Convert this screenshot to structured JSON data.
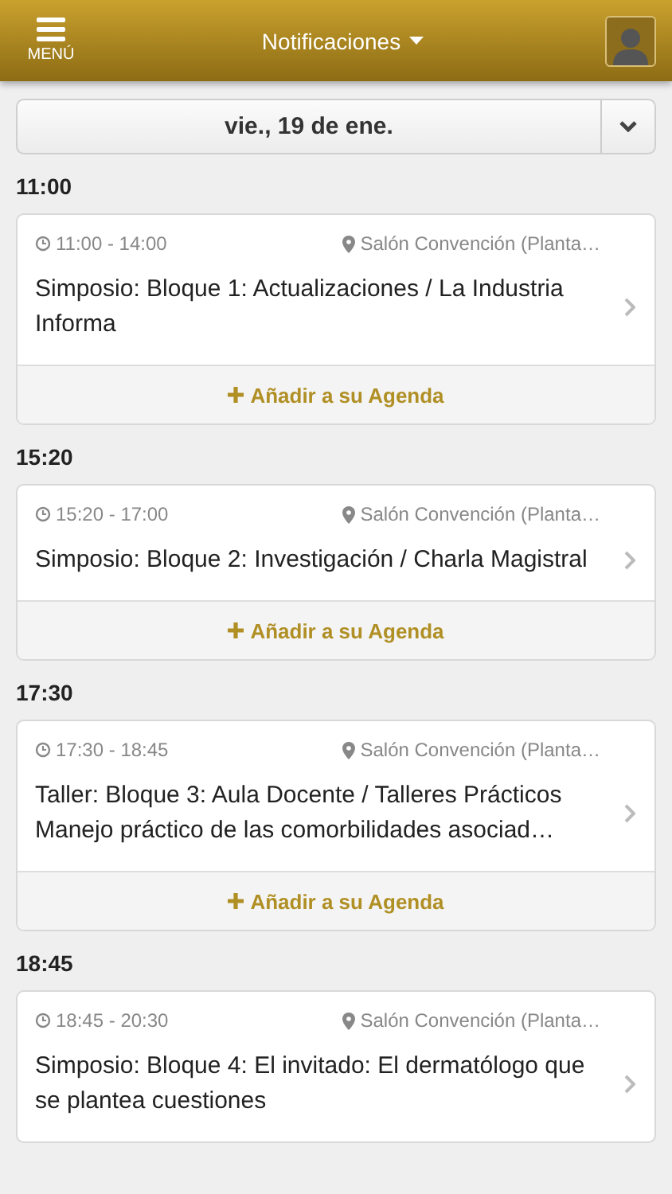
{
  "header": {
    "menu_label": "MENÚ",
    "title": "Notificaciones"
  },
  "date_picker": {
    "value": "vie., 19 de ene."
  },
  "sessions": [
    {
      "heading": "11:00",
      "time": "11:00 - 14:00",
      "location": "Salón Convención (Planta…",
      "title": "Simposio: Bloque 1: Actualizaciones / La Industria Informa",
      "add_label": "Añadir a su Agenda"
    },
    {
      "heading": "15:20",
      "time": "15:20 - 17:00",
      "location": "Salón Convención (Planta…",
      "title": "Simposio: Bloque 2: Investigación / Charla Magistral",
      "add_label": "Añadir a su Agenda"
    },
    {
      "heading": "17:30",
      "time": "17:30 - 18:45",
      "location": "Salón Convención (Planta…",
      "title": "Taller: Bloque 3: Aula Docente / Talleres Prácticos",
      "subtitle": "Manejo práctico de las comorbilidades asociad…",
      "add_label": "Añadir a su Agenda"
    },
    {
      "heading": "18:45",
      "time": "18:45 - 20:30",
      "location": "Salón Convención (Planta…",
      "title": "Simposio: Bloque 4: El invitado: El dermatólogo que se plantea cuestiones"
    }
  ]
}
